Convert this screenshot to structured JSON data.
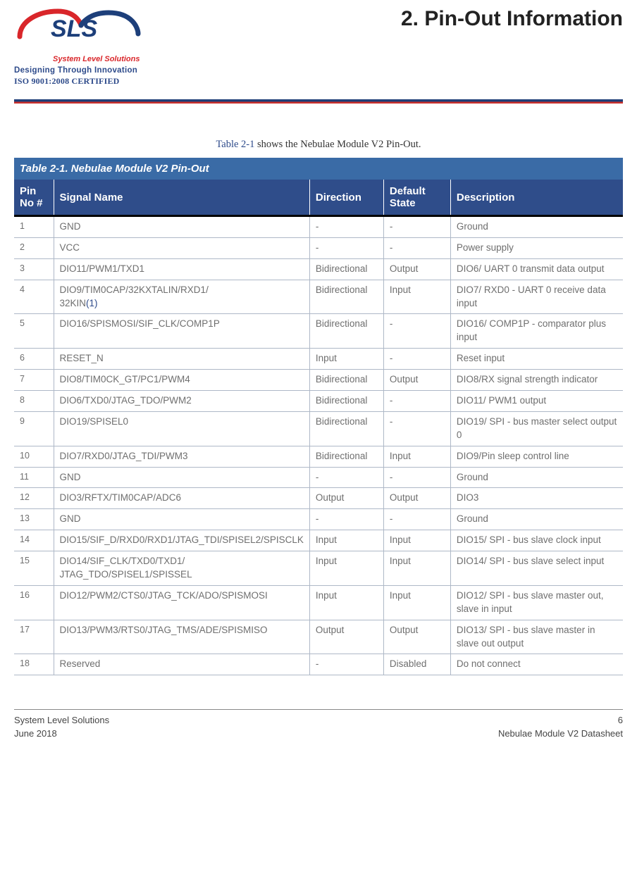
{
  "header": {
    "logo_text": "SLS",
    "logo_sub": "System Level Solutions",
    "tagline": "Designing Through Innovation",
    "cert": "ISO 9001:2008 CERTIFIED",
    "section_title": "2. Pin-Out Information"
  },
  "intro": {
    "ref": "Table 2-1",
    "rest": " shows the Nebulae Module V2 Pin-Out."
  },
  "table": {
    "title": "Table 2-1.  Nebulae Module V2 Pin-Out",
    "columns": {
      "pin": "Pin No #",
      "signal": "Signal Name",
      "dir": "Direction",
      "def": "Default State",
      "desc": "Description"
    },
    "rows": [
      {
        "pin": "1",
        "signal": "GND",
        "annot": "",
        "dir": "-",
        "def": "-",
        "desc": "Ground"
      },
      {
        "pin": "2",
        "signal": "VCC",
        "annot": "",
        "dir": "-",
        "def": "-",
        "desc": "Power supply"
      },
      {
        "pin": "3",
        "signal": "DIO11/PWM1/TXD1",
        "annot": "",
        "dir": "Bidirectional",
        "def": "Output",
        "desc": "DIO6/ UART 0 transmit data output"
      },
      {
        "pin": "4",
        "signal": "DIO9/TIM0CAP/32KXTALIN/RXD1/\n32KIN",
        "annot": "(1)",
        "dir": "Bidirectional",
        "def": "Input",
        "desc": "DIO7/ RXD0 - UART 0 receive data input"
      },
      {
        "pin": "5",
        "signal": "DIO16/SPISMOSI/SIF_CLK/COMP1P",
        "annot": "",
        "dir": "Bidirectional",
        "def": "-",
        "desc": "DIO16/ COMP1P - comparator plus input"
      },
      {
        "pin": "6",
        "signal": "RESET_N",
        "annot": "",
        "dir": "Input",
        "def": "-",
        "desc": "Reset input"
      },
      {
        "pin": "7",
        "signal": "DIO8/TIM0CK_GT/PC1/PWM4",
        "annot": "",
        "dir": "Bidirectional",
        "def": "Output",
        "desc": "DIO8/RX signal strength indicator"
      },
      {
        "pin": "8",
        "signal": "DIO6/TXD0/JTAG_TDO/PWM2",
        "annot": "",
        "dir": "Bidirectional",
        "def": "-",
        "desc": "DIO11/ PWM1 output"
      },
      {
        "pin": "9",
        "signal": "DIO19/SPISEL0",
        "annot": "",
        "dir": "Bidirectional",
        "def": "-",
        "desc": "DIO19/ SPI - bus master select output 0"
      },
      {
        "pin": "10",
        "signal": "DIO7/RXD0/JTAG_TDI/PWM3",
        "annot": "",
        "dir": "Bidirectional",
        "def": "Input",
        "desc": "DIO9/Pin sleep control line"
      },
      {
        "pin": "11",
        "signal": "GND",
        "annot": "",
        "dir": "-",
        "def": "-",
        "desc": "Ground"
      },
      {
        "pin": "12",
        "signal": "DIO3/RFTX/TIM0CAP/ADC6",
        "annot": "",
        "dir": "Output",
        "def": "Output",
        "desc": "DIO3"
      },
      {
        "pin": "13",
        "signal": "GND",
        "annot": "",
        "dir": "-",
        "def": "-",
        "desc": "Ground"
      },
      {
        "pin": "14",
        "signal": "DIO15/SIF_D/RXD0/RXD1/JTAG_TDI/SPISEL2/SPISCLK",
        "annot": "",
        "dir": "Input",
        "def": "Input",
        "desc": "DIO15/ SPI - bus slave clock input"
      },
      {
        "pin": "15",
        "signal": "DIO14/SIF_CLK/TXD0/TXD1/\nJTAG_TDO/SPISEL1/SPISSEL",
        "annot": "",
        "dir": "Input",
        "def": "Input",
        "desc": "DIO14/ SPI - bus slave select input"
      },
      {
        "pin": "16",
        "signal": "DIO12/PWM2/CTS0/JTAG_TCK/ADO/SPISMOSI",
        "annot": "",
        "dir": "Input",
        "def": "Input",
        "desc": "DIO12/ SPI - bus slave master out, slave in input"
      },
      {
        "pin": "17",
        "signal": "DIO13/PWM3/RTS0/JTAG_TMS/ADE/SPISMISO",
        "annot": "",
        "dir": "Output",
        "def": "Output",
        "desc": "DIO13/ SPI - bus slave master in slave out output"
      },
      {
        "pin": "18",
        "signal": "Reserved",
        "annot": "",
        "dir": "-",
        "def": "Disabled",
        "desc": "Do not connect"
      }
    ]
  },
  "footer": {
    "left1": "System Level Solutions",
    "left2": "June 2018",
    "right1": "6",
    "right2": "Nebulae Module V2 Datasheet"
  }
}
